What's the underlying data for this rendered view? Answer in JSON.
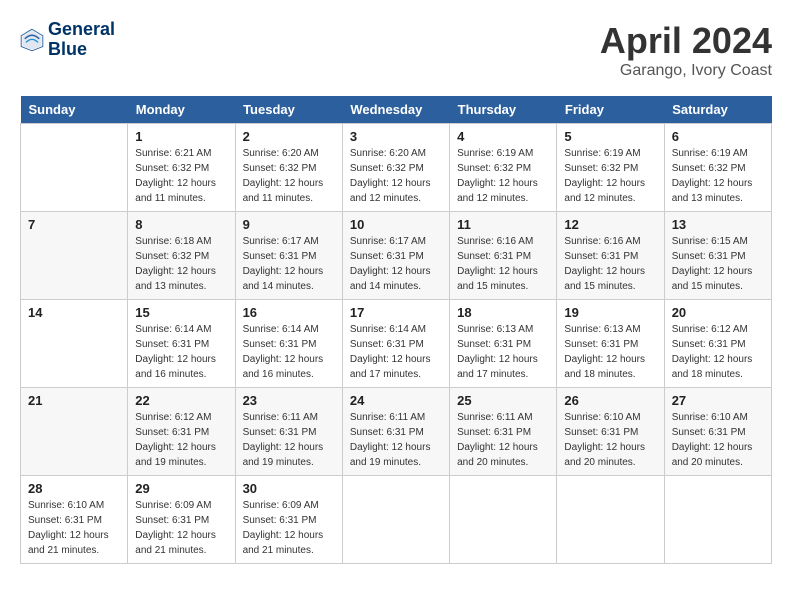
{
  "header": {
    "logo_line1": "General",
    "logo_line2": "Blue",
    "month_title": "April 2024",
    "location": "Garango, Ivory Coast"
  },
  "days_of_week": [
    "Sunday",
    "Monday",
    "Tuesday",
    "Wednesday",
    "Thursday",
    "Friday",
    "Saturday"
  ],
  "weeks": [
    [
      {
        "day": "",
        "info": ""
      },
      {
        "day": "1",
        "info": "Sunrise: 6:21 AM\nSunset: 6:32 PM\nDaylight: 12 hours\nand 11 minutes."
      },
      {
        "day": "2",
        "info": "Sunrise: 6:20 AM\nSunset: 6:32 PM\nDaylight: 12 hours\nand 11 minutes."
      },
      {
        "day": "3",
        "info": "Sunrise: 6:20 AM\nSunset: 6:32 PM\nDaylight: 12 hours\nand 12 minutes."
      },
      {
        "day": "4",
        "info": "Sunrise: 6:19 AM\nSunset: 6:32 PM\nDaylight: 12 hours\nand 12 minutes."
      },
      {
        "day": "5",
        "info": "Sunrise: 6:19 AM\nSunset: 6:32 PM\nDaylight: 12 hours\nand 12 minutes."
      },
      {
        "day": "6",
        "info": "Sunrise: 6:19 AM\nSunset: 6:32 PM\nDaylight: 12 hours\nand 13 minutes."
      }
    ],
    [
      {
        "day": "7",
        "info": ""
      },
      {
        "day": "8",
        "info": "Sunrise: 6:18 AM\nSunset: 6:32 PM\nDaylight: 12 hours\nand 13 minutes."
      },
      {
        "day": "9",
        "info": "Sunrise: 6:17 AM\nSunset: 6:31 PM\nDaylight: 12 hours\nand 14 minutes."
      },
      {
        "day": "10",
        "info": "Sunrise: 6:17 AM\nSunset: 6:31 PM\nDaylight: 12 hours\nand 14 minutes."
      },
      {
        "day": "11",
        "info": "Sunrise: 6:16 AM\nSunset: 6:31 PM\nDaylight: 12 hours\nand 15 minutes."
      },
      {
        "day": "12",
        "info": "Sunrise: 6:16 AM\nSunset: 6:31 PM\nDaylight: 12 hours\nand 15 minutes."
      },
      {
        "day": "13",
        "info": "Sunrise: 6:15 AM\nSunset: 6:31 PM\nDaylight: 12 hours\nand 15 minutes."
      }
    ],
    [
      {
        "day": "14",
        "info": ""
      },
      {
        "day": "15",
        "info": "Sunrise: 6:14 AM\nSunset: 6:31 PM\nDaylight: 12 hours\nand 16 minutes."
      },
      {
        "day": "16",
        "info": "Sunrise: 6:14 AM\nSunset: 6:31 PM\nDaylight: 12 hours\nand 16 minutes."
      },
      {
        "day": "17",
        "info": "Sunrise: 6:14 AM\nSunset: 6:31 PM\nDaylight: 12 hours\nand 17 minutes."
      },
      {
        "day": "18",
        "info": "Sunrise: 6:13 AM\nSunset: 6:31 PM\nDaylight: 12 hours\nand 17 minutes."
      },
      {
        "day": "19",
        "info": "Sunrise: 6:13 AM\nSunset: 6:31 PM\nDaylight: 12 hours\nand 18 minutes."
      },
      {
        "day": "20",
        "info": "Sunrise: 6:12 AM\nSunset: 6:31 PM\nDaylight: 12 hours\nand 18 minutes."
      }
    ],
    [
      {
        "day": "21",
        "info": ""
      },
      {
        "day": "22",
        "info": "Sunrise: 6:12 AM\nSunset: 6:31 PM\nDaylight: 12 hours\nand 19 minutes."
      },
      {
        "day": "23",
        "info": "Sunrise: 6:11 AM\nSunset: 6:31 PM\nDaylight: 12 hours\nand 19 minutes."
      },
      {
        "day": "24",
        "info": "Sunrise: 6:11 AM\nSunset: 6:31 PM\nDaylight: 12 hours\nand 19 minutes."
      },
      {
        "day": "25",
        "info": "Sunrise: 6:11 AM\nSunset: 6:31 PM\nDaylight: 12 hours\nand 20 minutes."
      },
      {
        "day": "26",
        "info": "Sunrise: 6:10 AM\nSunset: 6:31 PM\nDaylight: 12 hours\nand 20 minutes."
      },
      {
        "day": "27",
        "info": "Sunrise: 6:10 AM\nSunset: 6:31 PM\nDaylight: 12 hours\nand 20 minutes."
      }
    ],
    [
      {
        "day": "28",
        "info": "Sunrise: 6:10 AM\nSunset: 6:31 PM\nDaylight: 12 hours\nand 21 minutes."
      },
      {
        "day": "29",
        "info": "Sunrise: 6:09 AM\nSunset: 6:31 PM\nDaylight: 12 hours\nand 21 minutes."
      },
      {
        "day": "30",
        "info": "Sunrise: 6:09 AM\nSunset: 6:31 PM\nDaylight: 12 hours\nand 21 minutes."
      },
      {
        "day": "",
        "info": ""
      },
      {
        "day": "",
        "info": ""
      },
      {
        "day": "",
        "info": ""
      },
      {
        "day": "",
        "info": ""
      }
    ]
  ]
}
